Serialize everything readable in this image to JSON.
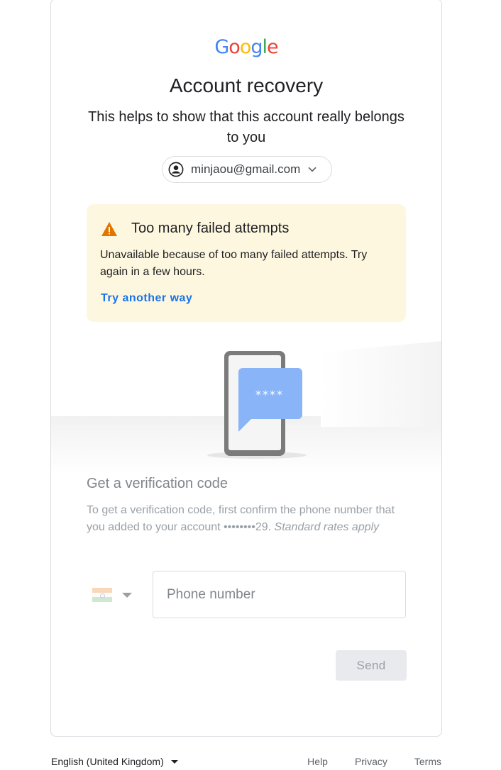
{
  "logo": {
    "letters": [
      "G",
      "o",
      "o",
      "g",
      "l",
      "e"
    ]
  },
  "header": {
    "title": "Account recovery",
    "subtitle": "This helps to show that this account really belongs to you"
  },
  "account": {
    "email": "minjaou@gmail.com",
    "icon": "account-circle-icon"
  },
  "warning": {
    "icon": "warning-triangle-icon",
    "title": "Too many failed attempts",
    "body": "Unavailable because of too many failed attempts. Try again in a few hours.",
    "link": "Try another way"
  },
  "illustration": {
    "bubble_text": "****"
  },
  "verification": {
    "title": "Get a verification code",
    "body_prefix": "To get a verification code, first confirm the phone number that you added to your account ••••••••29. ",
    "body_note": "Standard rates apply",
    "country_flag": "india-flag-icon",
    "phone_placeholder": "Phone number",
    "phone_value": "",
    "send_label": "Send"
  },
  "footer": {
    "language": "English (United Kingdom)",
    "links": [
      "Help",
      "Privacy",
      "Terms"
    ]
  },
  "colors": {
    "accent": "#1a73e8",
    "warning_bg": "#fef7e0",
    "warning_icon": "#e37400"
  }
}
